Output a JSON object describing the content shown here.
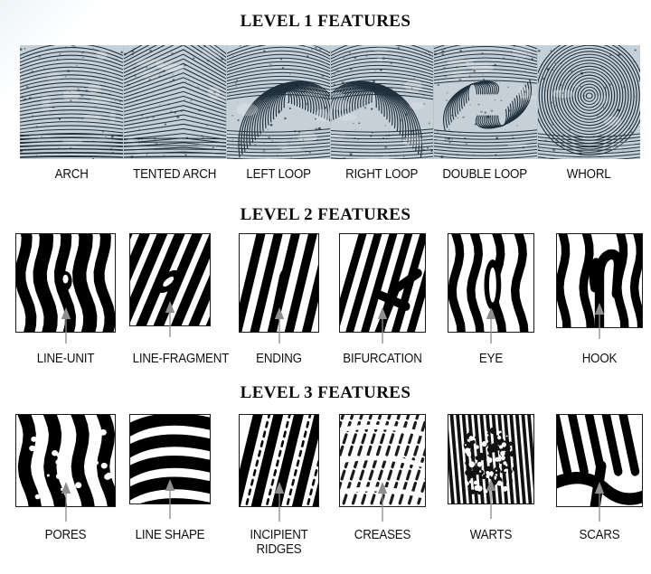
{
  "figure": {
    "title_l1": "LEVEL 1 FEATURES",
    "title_l2": "LEVEL 2 FEATURES",
    "title_l3": "LEVEL 3 FEATURES",
    "background_color": "#ffffff",
    "ink_color": "#111111"
  },
  "level1": {
    "heading": "LEVEL 1 FEATURES",
    "items": [
      {
        "label": "ARCH",
        "pattern": "arch"
      },
      {
        "label": "TENTED ARCH",
        "pattern": "tented-arch"
      },
      {
        "label": "LEFT LOOP",
        "pattern": "left-loop"
      },
      {
        "label": "RIGHT LOOP",
        "pattern": "right-loop"
      },
      {
        "label": "DOUBLE LOOP",
        "pattern": "double-loop"
      },
      {
        "label": "WHORL",
        "pattern": "whorl"
      }
    ]
  },
  "level2": {
    "heading": "LEVEL 2 FEATURES",
    "items": [
      {
        "label": "LINE-UNIT",
        "pattern": "line-unit"
      },
      {
        "label": "LINE-FRAGMENT",
        "pattern": "line-fragment"
      },
      {
        "label": "ENDING",
        "pattern": "ending"
      },
      {
        "label": "BIFURCATION",
        "pattern": "bifurcation"
      },
      {
        "label": "EYE",
        "pattern": "eye"
      },
      {
        "label": "HOOK",
        "pattern": "hook"
      }
    ]
  },
  "level3": {
    "heading": "LEVEL 3 FEATURES",
    "items": [
      {
        "label": "PORES",
        "label2": "",
        "pattern": "pores"
      },
      {
        "label": "LINE SHAPE",
        "label2": "",
        "pattern": "line-shape"
      },
      {
        "label": "INCIPIENT",
        "label2": "RIDGES",
        "pattern": "incipient-ridges"
      },
      {
        "label": "CREASES",
        "label2": "",
        "pattern": "creases"
      },
      {
        "label": "WARTS",
        "label2": "",
        "pattern": "warts"
      },
      {
        "label": "SCARS",
        "label2": "",
        "pattern": "scars"
      }
    ]
  }
}
